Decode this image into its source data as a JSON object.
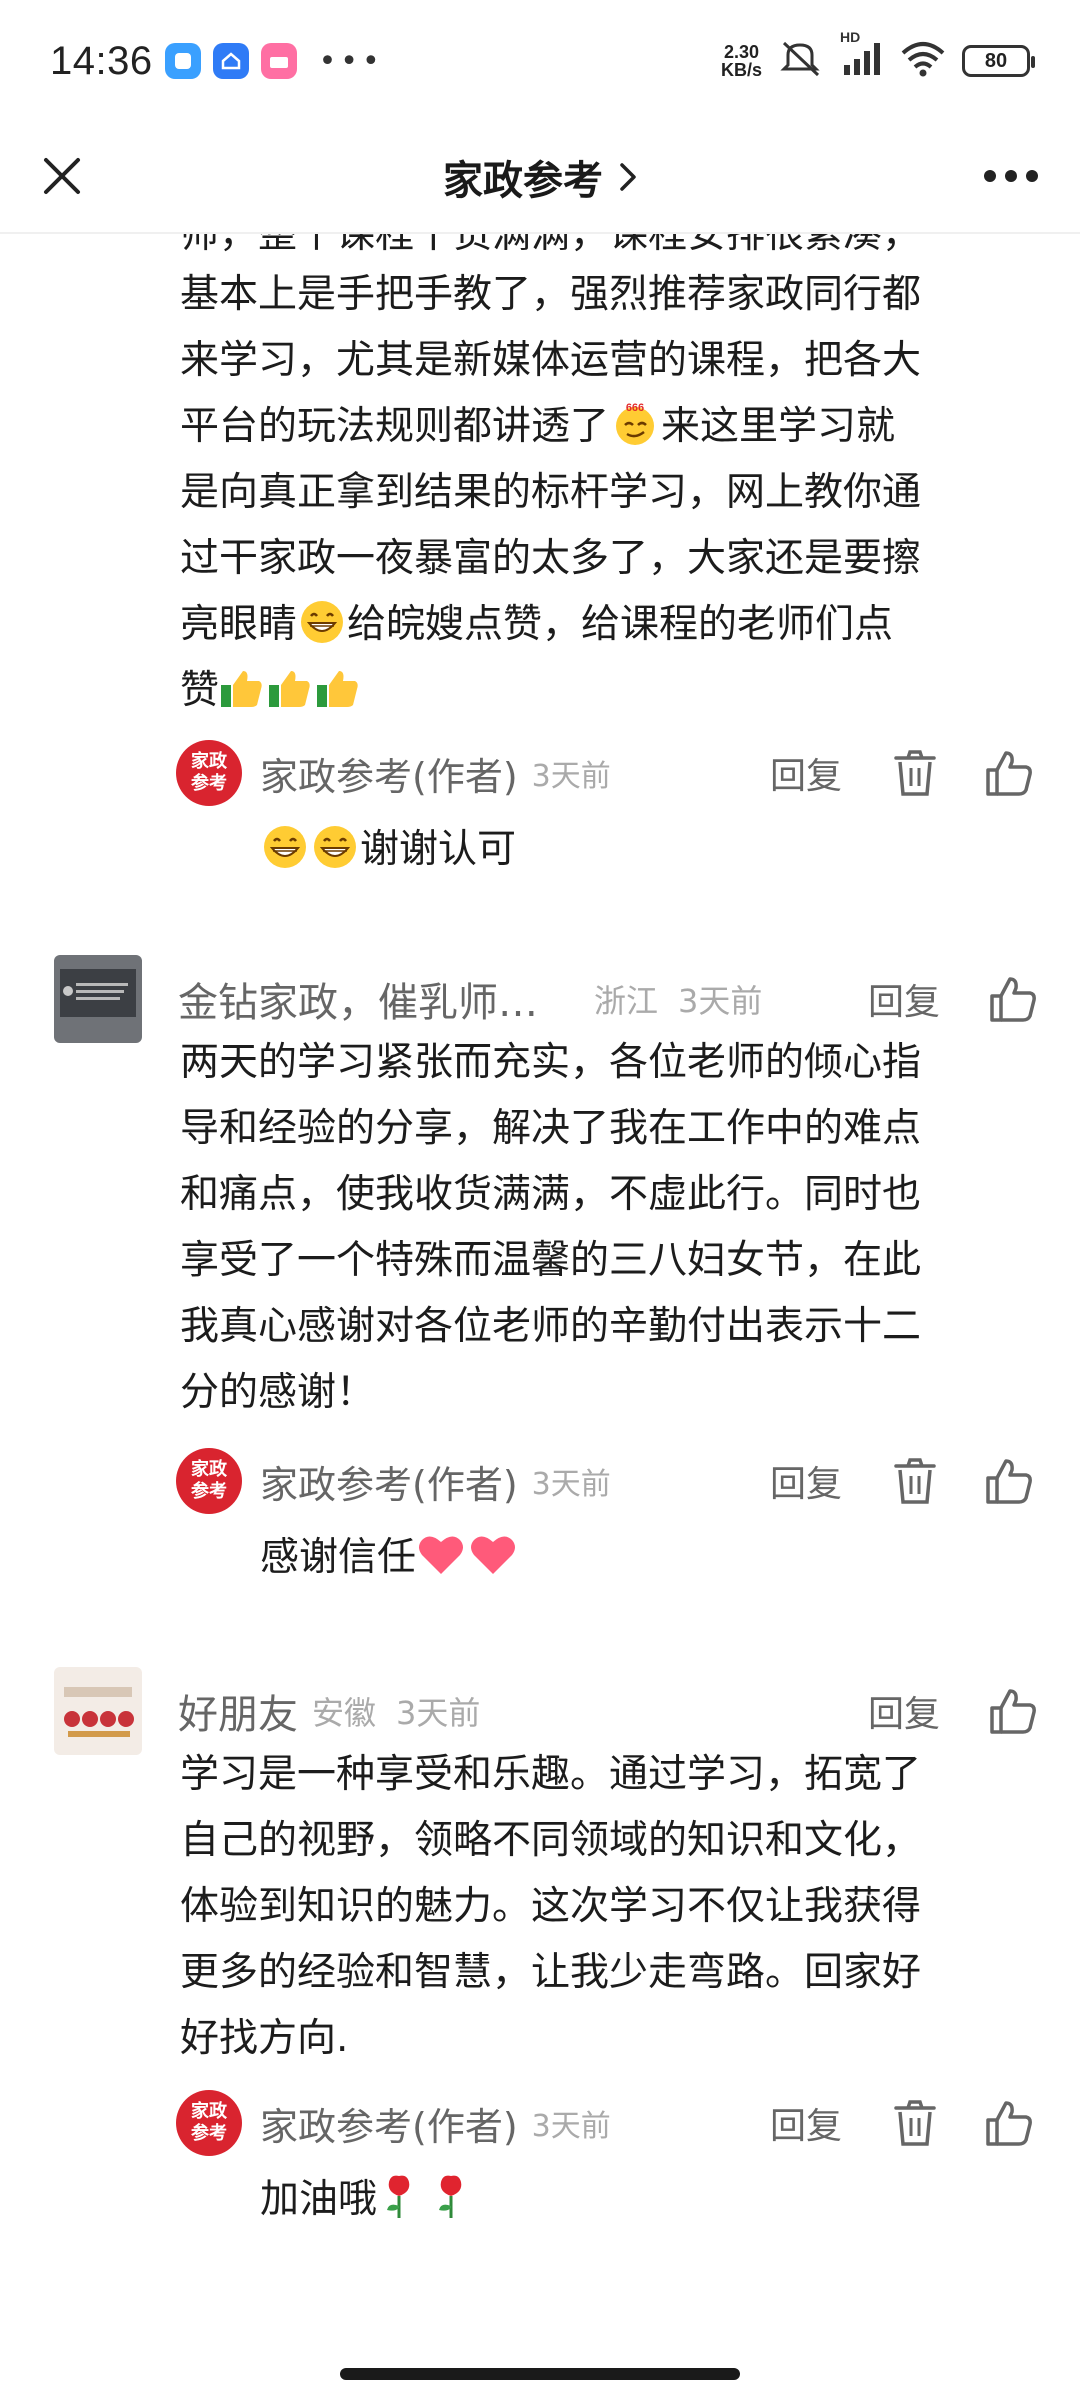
{
  "status_bar": {
    "time": "14:36",
    "net_speed_value": "2.30",
    "net_speed_unit": "KB/s",
    "hd_label": "HD",
    "battery": "80"
  },
  "nav": {
    "title": "家政参考",
    "close_icon": "close-icon",
    "more_icon": "more-icon"
  },
  "first_comment_tail": {
    "cut_line": "师，整个课程干货满满，课程安排很紧凑，",
    "lines": [
      "基本上是手把手教了，强烈推荐家政同行都",
      "来学习，尤其是新媒体运营的课程，把各大",
      "平台的玩法规则都讲透了",
      "来这里学习就",
      "是向真正拿到结果的标杆学习，网上教你通",
      "过干家政一夜暴富的太多了，大家还是要擦",
      "亮眼睛",
      "给皖嫂点赞，给课程的老师们点",
      "赞"
    ],
    "emoji_666": "666",
    "reply": {
      "avatar_top": "家政",
      "avatar_bottom": "参考",
      "name": "家政参考(作者)",
      "time": "3天前",
      "reply_label": "回复",
      "text": "谢谢认可"
    }
  },
  "comments": [
    {
      "user": "金钻家政，催乳师…",
      "location": "浙江",
      "time": "3天前",
      "reply_label": "回复",
      "text_lines": [
        "两天的学习紧张而充实，各位老师的倾心指",
        "导和经验的分享，解决了我在工作中的难点",
        "和痛点，使我收货满满，不虚此行。同时也",
        "享受了一个特殊而温馨的三八妇女节，在此",
        "我真心感谢对各位老师的辛勤付出表示十二",
        "分的感谢！"
      ],
      "reply": {
        "avatar_top": "家政",
        "avatar_bottom": "参考",
        "name": "家政参考(作者)",
        "time": "3天前",
        "reply_label": "回复",
        "text": "感谢信任"
      }
    },
    {
      "user": "好朋友",
      "location": "安徽",
      "time": "3天前",
      "reply_label": "回复",
      "text_lines": [
        "学习是一种享受和乐趣。通过学习，拓宽了",
        "自己的视野，领略不同领域的知识和文化，",
        "体验到知识的魅力。这次学习不仅让我获得",
        "更多的经验和智慧，让我少走弯路。回家好",
        "好找方向."
      ],
      "reply": {
        "avatar_top": "家政",
        "avatar_bottom": "参考",
        "name": "家政参考(作者)",
        "time": "3天前",
        "reply_label": "回复",
        "text": "加油哦"
      }
    }
  ],
  "colors": {
    "author_red": "#d9242f",
    "muted_text": "#666666",
    "light_text": "#aaaaaa"
  }
}
